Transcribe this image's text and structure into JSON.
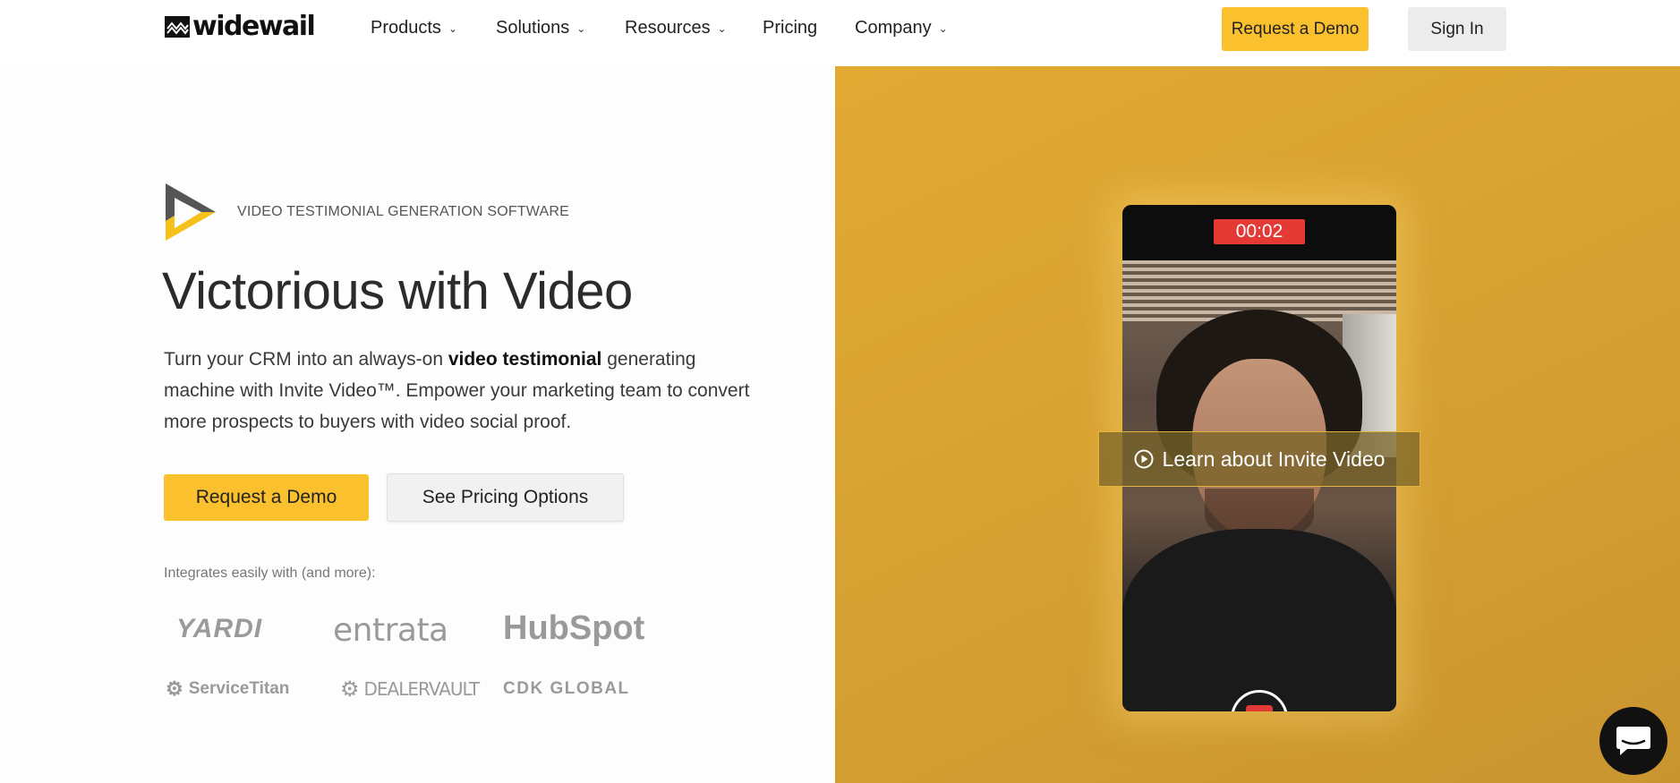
{
  "nav": {
    "brand": "widewail",
    "items": [
      {
        "label": "Products",
        "has_dropdown": true
      },
      {
        "label": "Solutions",
        "has_dropdown": true
      },
      {
        "label": "Resources",
        "has_dropdown": true
      },
      {
        "label": "Pricing",
        "has_dropdown": false
      },
      {
        "label": "Company",
        "has_dropdown": true
      }
    ],
    "demo_label": "Request a Demo",
    "signin_label": "Sign In"
  },
  "hero": {
    "eyebrow": "VIDEO TESTIMONIAL GENERATION SOFTWARE",
    "headline": "Victorious with Video",
    "desc_pre": "Turn your CRM into an always-on ",
    "desc_bold": "video testimonial",
    "desc_post": " generating machine with Invite Video™. Empower your marketing team to convert more prospects to buyers with video social proof.",
    "cta_primary": "Request a Demo",
    "cta_secondary": "See Pricing Options",
    "integrations_label": "Integrates easily with (and more):",
    "partners": [
      "YARDI",
      "entrata",
      "HubSpot",
      "ServiceTitan",
      "DEALERVAULT",
      "CDK GLOBAL"
    ]
  },
  "media": {
    "timer": "00:02",
    "learn_label": "Learn about Invite Video"
  },
  "colors": {
    "accent": "#fbc02d",
    "hero_bg": "#d8a232",
    "record": "#e53935"
  },
  "icons": [
    "widewail-logo-icon",
    "chevron-down-icon",
    "play-triangle-icon",
    "play-circle-icon",
    "record-stop-icon",
    "chat-bubble-icon"
  ]
}
